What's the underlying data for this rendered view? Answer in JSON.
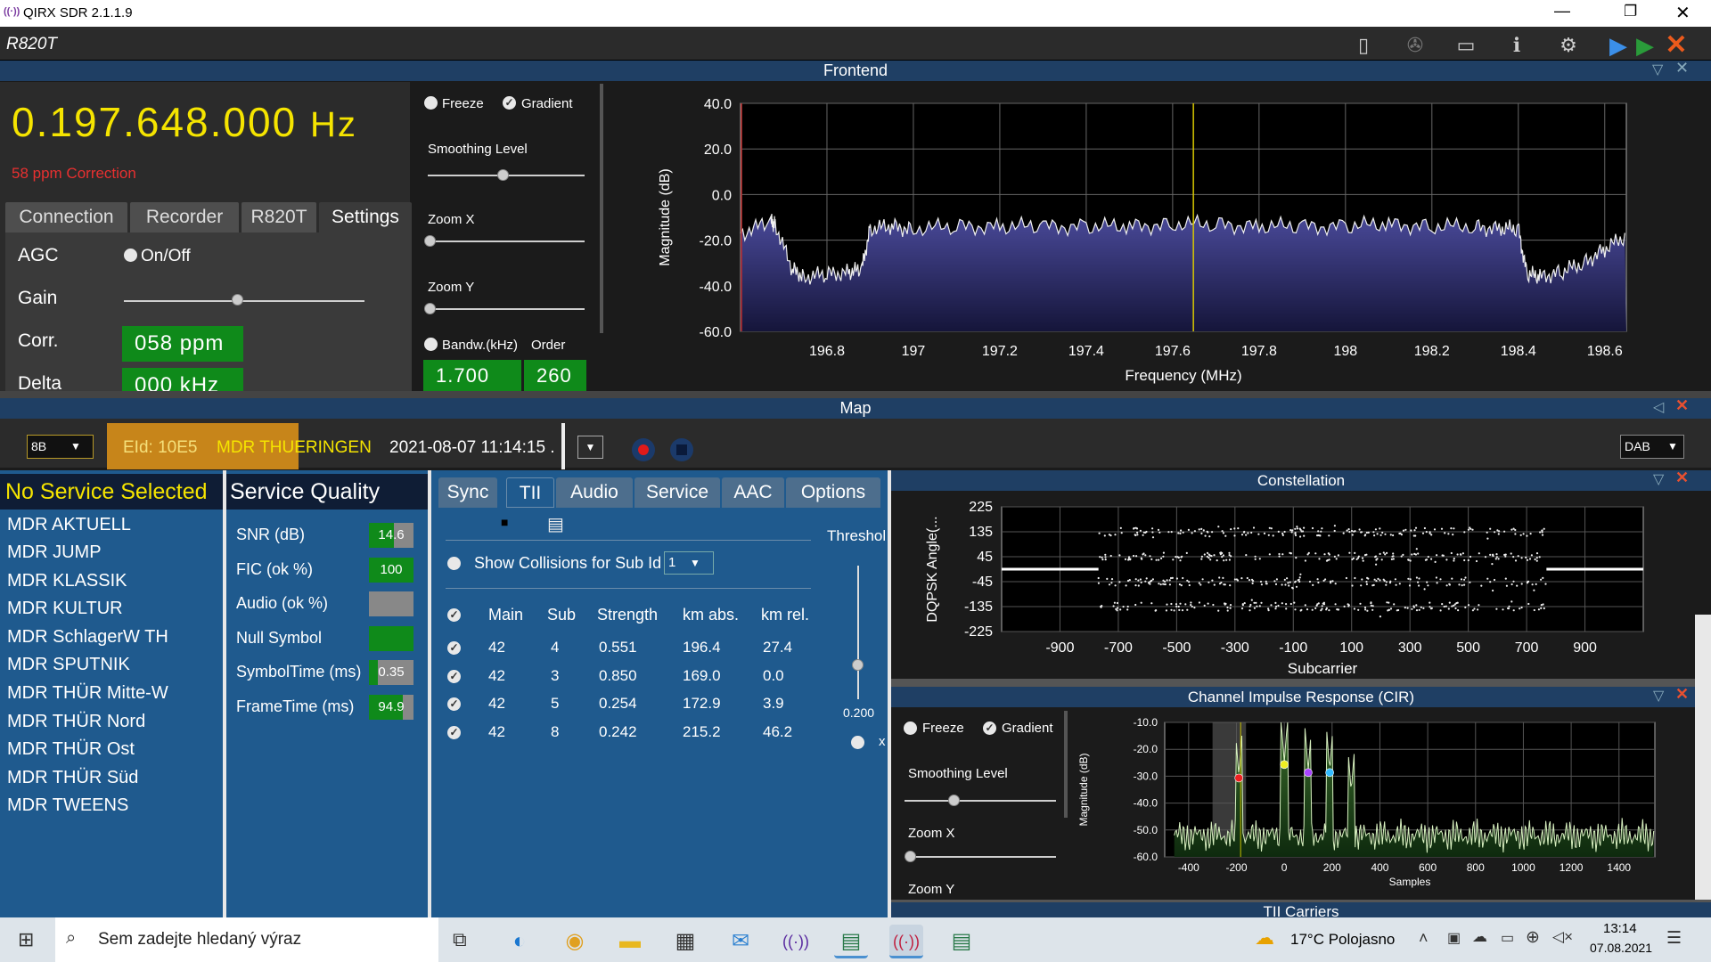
{
  "window": {
    "title": "QIRX SDR 2.1.1.9"
  },
  "app": {
    "device": "R820T"
  },
  "frontend": {
    "header": "Frontend",
    "frequency": "0.197.648.000",
    "frequency_unit": "Hz",
    "correction": "58 ppm Correction",
    "tabs": [
      "Connection",
      "Recorder",
      "R820T",
      "Settings"
    ],
    "settings": {
      "agc_label": "AGC",
      "agc_toggle": "On/Off",
      "gain_label": "Gain",
      "corr_label": "Corr.",
      "corr_value": "058 ppm",
      "delta_label": "Delta",
      "delta_value": "000 kHz"
    },
    "spectrum_controls": {
      "freeze": "Freeze",
      "gradient": "Gradient",
      "smoothing": "Smoothing Level",
      "zoom_x": "Zoom X",
      "zoom_y": "Zoom Y",
      "bandw": "Bandw.(kHz)",
      "order": "Order",
      "bandw_value": "1.700",
      "order_value": "260"
    }
  },
  "map": {
    "header": "Map",
    "channel": "8B",
    "eid": "EId: 10E5",
    "ensemble": "MDR THUERINGEN",
    "datetime": "2021-08-07  11:14:15 .",
    "mode": "DAB"
  },
  "services": {
    "selected": "No Service Selected",
    "items": [
      "MDR AKTUELL",
      "MDR JUMP",
      "MDR KLASSIK",
      "MDR KULTUR",
      "MDR SchlagerW TH",
      "MDR SPUTNIK",
      "MDR THÜR Mitte-W",
      "MDR THÜR Nord",
      "MDR THÜR Ost",
      "MDR THÜR Süd",
      "MDR TWEENS"
    ]
  },
  "quality": {
    "title": "Service Quality",
    "rows": [
      {
        "label": "SNR (dB)",
        "value": "14.6",
        "fill": 0.55
      },
      {
        "label": "FIC (ok %)",
        "value": "100",
        "fill": 1.0
      },
      {
        "label": "Audio (ok %)",
        "value": "",
        "fill": 0.0
      },
      {
        "label": "Null Symbol",
        "value": "",
        "fill": 1.0
      },
      {
        "label": "SymbolTime (ms)",
        "value": "0.35",
        "fill": 0.2
      },
      {
        "label": "FrameTime (ms)",
        "value": "94.9",
        "fill": 0.75
      }
    ]
  },
  "tii": {
    "tabs": [
      "Sync",
      "TII",
      "Audio",
      "Service",
      "AAC",
      "Options"
    ],
    "collisions_label": "Show Collisions for Sub Id",
    "collisions_value": "1",
    "threshold_label": "Threshol",
    "threshold_value": "0.200",
    "x_label": "x",
    "columns": [
      "Main",
      "Sub",
      "Strength",
      "km abs.",
      "km rel."
    ],
    "rows": [
      [
        "42",
        "4",
        "0.551",
        "196.4",
        "27.4"
      ],
      [
        "42",
        "3",
        "0.850",
        "169.0",
        "0.0"
      ],
      [
        "42",
        "5",
        "0.254",
        "172.9",
        "3.9"
      ],
      [
        "42",
        "8",
        "0.242",
        "215.2",
        "46.2"
      ]
    ]
  },
  "constellation": {
    "header": "Constellation"
  },
  "cir": {
    "header": "Channel Impulse Response (CIR)",
    "freeze": "Freeze",
    "gradient": "Gradient",
    "smoothing": "Smoothing Level",
    "zoom_x": "Zoom X",
    "zoom_y": "Zoom Y"
  },
  "tii_carriers": {
    "header": "TII Carriers"
  },
  "taskbar": {
    "search_placeholder": "Sem zadejte hledaný výraz",
    "weather": "17°C  Polojasno",
    "time": "13:14",
    "date": "07.08.2021"
  },
  "chart_data": [
    {
      "type": "line",
      "name": "frontend-spectrum",
      "xlabel": "Frequency (MHz)",
      "ylabel": "Magnitude (dB)",
      "xlim": [
        196.6,
        198.65
      ],
      "ylim": [
        -60,
        40
      ],
      "xticks": [
        "196.8",
        "197",
        "197.2",
        "197.4",
        "197.6",
        "197.8",
        "198",
        "198.2",
        "198.4",
        "198.6"
      ],
      "yticks": [
        "40.0",
        "20.0",
        "0.0",
        "-20.0",
        "-40.0",
        "-60.0"
      ],
      "x": [
        196.6,
        196.67,
        196.68,
        196.72,
        196.75,
        196.8,
        196.85,
        196.88,
        196.9,
        196.95,
        197.0,
        197.1,
        197.2,
        197.3,
        197.4,
        197.5,
        197.6,
        197.7,
        197.8,
        197.9,
        198.0,
        198.1,
        198.2,
        198.3,
        198.36,
        198.4,
        198.42,
        198.45,
        198.5,
        198.55,
        198.6,
        198.65
      ],
      "y": [
        -17,
        -12,
        -13,
        -33,
        -36,
        -35,
        -34,
        -33,
        -15,
        -14,
        -15,
        -14,
        -14,
        -14,
        -14,
        -14,
        -13,
        -13,
        -14,
        -14,
        -14,
        -13,
        -14,
        -14,
        -15,
        -15,
        -35,
        -36,
        -34,
        -30,
        -24,
        -18
      ],
      "marker_x": 197.648,
      "grid": true
    },
    {
      "type": "scatter",
      "name": "constellation",
      "xlabel": "Subcarrier",
      "ylabel": "DQPSK  Angle(...",
      "xlim": [
        -1100,
        1100
      ],
      "ylim": [
        -225,
        225
      ],
      "xticks": [
        "-900",
        "-700",
        "-500",
        "-300",
        "-100",
        "100",
        "300",
        "500",
        "700",
        "900"
      ],
      "yticks": [
        "225",
        "135",
        "45",
        "-45",
        "-135",
        "-225"
      ],
      "bands": [
        135,
        45,
        -45,
        -135
      ],
      "subcarrier_range": [
        -768,
        768
      ]
    },
    {
      "type": "line",
      "name": "cir",
      "xlabel": "Samples",
      "ylabel": "Magnitude (dB)",
      "xlim": [
        -500,
        1550
      ],
      "ylim": [
        -60,
        -10
      ],
      "xticks": [
        "-400",
        "-200",
        "0",
        "200",
        "400",
        "600",
        "800",
        "1000",
        "1200",
        "1400"
      ],
      "yticks": [
        "-10.0",
        "-20.0",
        "-30.0",
        "-40.0",
        "-50.0",
        "-60.0"
      ],
      "peaks": [
        {
          "x": -190,
          "y": -30,
          "color": "#e22"
        },
        {
          "x": 0,
          "y": -25,
          "color": "#ee2"
        },
        {
          "x": 100,
          "y": -28,
          "color": "#a4f"
        },
        {
          "x": 190,
          "y": -28,
          "color": "#3bf"
        },
        {
          "x": 280,
          "y": -36,
          "color": ""
        }
      ],
      "noise_floor": -52
    }
  ]
}
